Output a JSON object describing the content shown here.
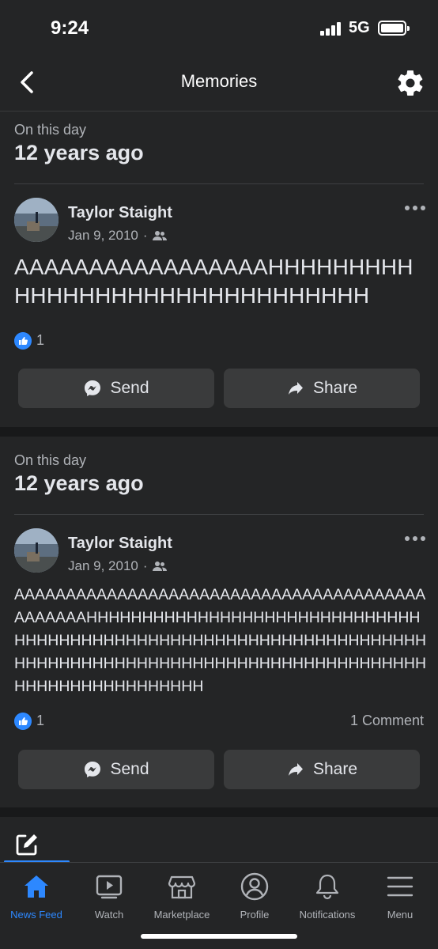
{
  "status_bar": {
    "time": "9:24",
    "network": "5G"
  },
  "header": {
    "title": "Memories"
  },
  "memories": [
    {
      "on_this_day": "On this day",
      "years_ago": "12 years ago",
      "author": "Taylor Staight",
      "date": "Jan 9, 2010",
      "separator": "·",
      "privacy_icon": "friends-icon",
      "text": "AAAAAAAAAAAAAAAAAHHHHHHHHHHHHHHHHHHHHHHHHHHHHHHH",
      "likes": "1",
      "comments": "",
      "send_label": "Send",
      "share_label": "Share"
    },
    {
      "on_this_day": "On this day",
      "years_ago": "12 years ago",
      "author": "Taylor Staight",
      "date": "Jan 9, 2010",
      "separator": "·",
      "privacy_icon": "friends-icon",
      "text": "AAAAAAAAAAAAAAAAAAAAAAAAAAAAAAAAAAAAAAAAAAAAAAAHHHHHHHHHHHHHHHHHHHHHHHHHHHHHHHHHHHHHHHHHHHHHHHHHHHHHHHHHHHHHHHHHHHHHHHHHHHHHHHHHHHHHHHHHHHHHHHHHHHHHHHHHHHHHHHHHHHHHHHHH",
      "likes": "1",
      "comments": "1 Comment",
      "send_label": "Send",
      "share_label": "Share"
    }
  ],
  "tabs": [
    {
      "label": "News Feed",
      "icon": "home-icon",
      "active": true
    },
    {
      "label": "Watch",
      "icon": "watch-icon",
      "active": false
    },
    {
      "label": "Marketplace",
      "icon": "marketplace-icon",
      "active": false
    },
    {
      "label": "Profile",
      "icon": "profile-icon",
      "active": false
    },
    {
      "label": "Notifications",
      "icon": "bell-icon",
      "active": false
    },
    {
      "label": "Menu",
      "icon": "menu-icon",
      "active": false
    }
  ],
  "colors": {
    "background": "#242526",
    "accent": "#2d88ff",
    "button": "#3a3b3c",
    "muted_text": "#b0b3b8"
  }
}
